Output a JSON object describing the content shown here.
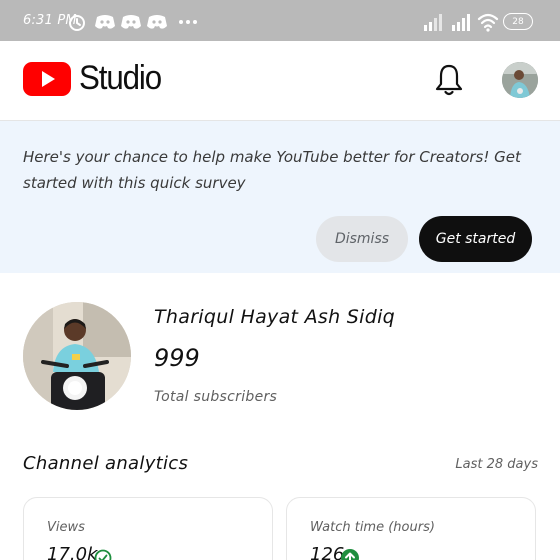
{
  "status_bar": {
    "time": "6:31 PM",
    "battery": "28"
  },
  "header": {
    "brand": "Studio",
    "icons": [
      "youtube-logo-icon",
      "bell-icon",
      "account-avatar"
    ]
  },
  "survey": {
    "message": "Here's your chance to help make YouTube better for Creators! Get started with this quick survey",
    "dismiss_label": "Dismiss",
    "start_label": "Get started"
  },
  "channel": {
    "name": "Thariqul Hayat Ash Sidiq",
    "subscribers": "999",
    "subscribers_label": "Total subscribers"
  },
  "analytics": {
    "title": "Channel analytics",
    "range": "Last 28 days",
    "cards": [
      {
        "label": "Views",
        "value": "17.0k",
        "trend": "check-circle-icon"
      },
      {
        "label": "Watch time (hours)",
        "value": "126",
        "trend": "arrow-up-circle-icon"
      }
    ]
  },
  "colors": {
    "brand_red": "#ff0000",
    "banner_bg": "#eef5fd",
    "status_bar_bg": "#b9b9b9",
    "positive_green": "#1e8e3e"
  }
}
